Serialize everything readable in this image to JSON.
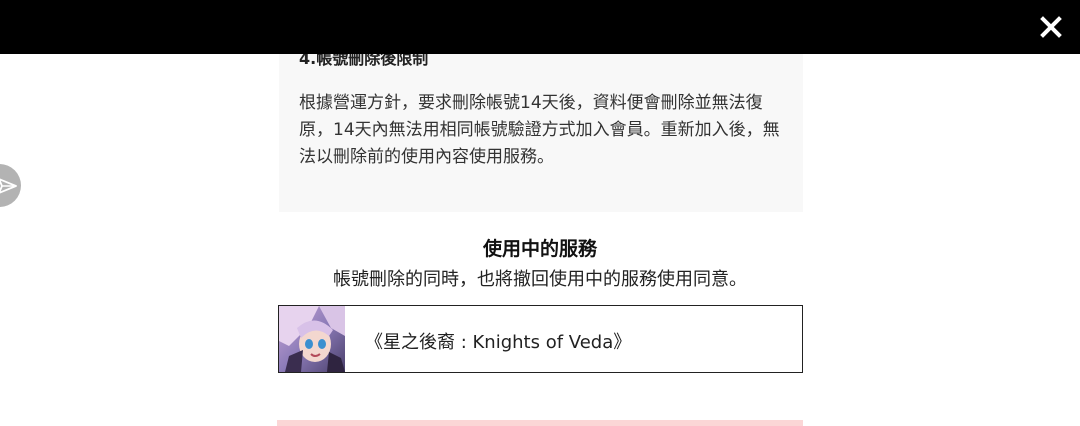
{
  "section": {
    "heading": "4.帳號刪除後限制",
    "body": "根據營運方針，要求刪除帳號14天後，資料便會刪除並無法復原，14天內無法用相同帳號驗證方式加入會員。重新加入後，無法以刪除前的使用內容使用服務。"
  },
  "services": {
    "title": "使用中的服務",
    "description": "帳號刪除的同時，也將撤回使用中的服務使用同意。",
    "items": [
      {
        "name": "《星之後裔 : Knights of Veda》",
        "icon": "game-thumbnail"
      }
    ]
  },
  "icons": {
    "close": "close-icon",
    "side": "send-icon"
  },
  "colors": {
    "topbar": "#000000",
    "info_box": "#f8f8f8",
    "side_button": "#b3b3b3",
    "bottom_strip": "#fbd6d6"
  }
}
